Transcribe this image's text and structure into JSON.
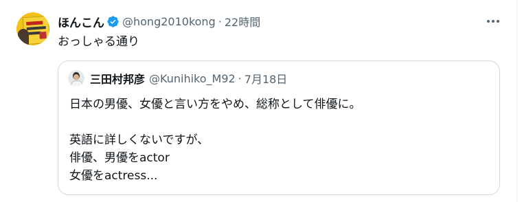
{
  "tweet": {
    "display_name": "ほんこん",
    "handle": "@hong2010kong",
    "separator": "·",
    "time": "22時間",
    "text": "おっしゃる通り",
    "verified_icon": "verified-badge-icon",
    "more_icon": "more-options-icon"
  },
  "quote": {
    "display_name": "三田村邦彦",
    "handle": "@Kunihiko_M92",
    "separator": "·",
    "time": "7月18日",
    "lines": [
      "日本の男優、女優と言い方をやめ、総称として俳優に。",
      "",
      "英語に詳しくないですが、",
      "俳優、男優をactor",
      "女優をactress..."
    ]
  },
  "colors": {
    "text_primary": "#0f1419",
    "text_secondary": "#536471",
    "verified_blue": "#1d9bf0",
    "border": "#cfd9de"
  }
}
